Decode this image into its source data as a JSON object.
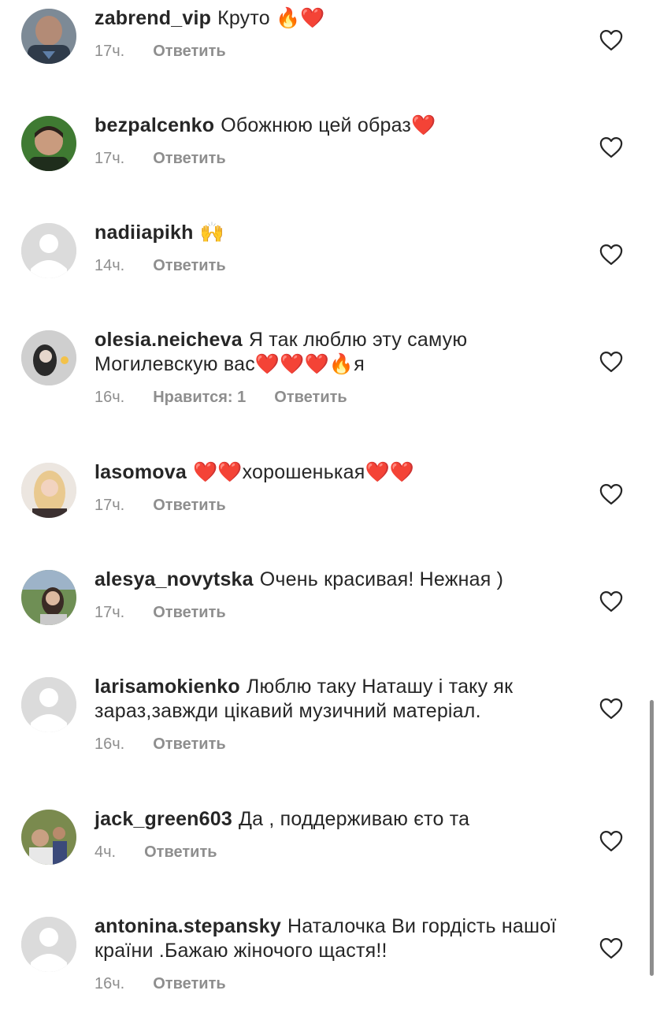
{
  "colors": {
    "text": "#262626",
    "meta": "#8e8e8e",
    "heart_outline": "#262626"
  },
  "comments": [
    {
      "username": "zabrend_vip",
      "text": "Круто 🔥❤️",
      "time": "17ч.",
      "likes": "",
      "reply": "Ответить",
      "avatar": "photo"
    },
    {
      "username": "bezpalcenko",
      "text": "Обожнюю цей образ❤️",
      "time": "17ч.",
      "likes": "",
      "reply": "Ответить",
      "avatar": "photo"
    },
    {
      "username": "nadiiapikh",
      "text": "🙌",
      "time": "14ч.",
      "likes": "",
      "reply": "Ответить",
      "avatar": "default"
    },
    {
      "username": "olesia.neicheva",
      "text": "Я так люблю эту самую Могилевскую вас❤️❤️❤️🔥я",
      "time": "16ч.",
      "likes": "Нравится: 1",
      "reply": "Ответить",
      "avatar": "photo"
    },
    {
      "username": "lasomova",
      "text": "❤️❤️хорошенькая❤️❤️",
      "time": "17ч.",
      "likes": "",
      "reply": "Ответить",
      "avatar": "photo"
    },
    {
      "username": "alesya_novytska",
      "text": "Очень красивая! Нежная )",
      "time": "17ч.",
      "likes": "",
      "reply": "Ответить",
      "avatar": "photo"
    },
    {
      "username": "larisamokienko",
      "text": "Люблю таку Наташу і таку як зараз,завжди цікавий музичний матеріал.",
      "time": "16ч.",
      "likes": "",
      "reply": "Ответить",
      "avatar": "default"
    },
    {
      "username": "jack_green603",
      "text": "Да , поддерживаю єто та",
      "time": "4ч.",
      "likes": "",
      "reply": "Ответить",
      "avatar": "photo"
    },
    {
      "username": "antonina.stepansky",
      "text": "Наталочка Ви гордість нашої країни .Бажаю жіночого щастя!!",
      "time": "16ч.",
      "likes": "",
      "reply": "Ответить",
      "avatar": "default"
    }
  ]
}
